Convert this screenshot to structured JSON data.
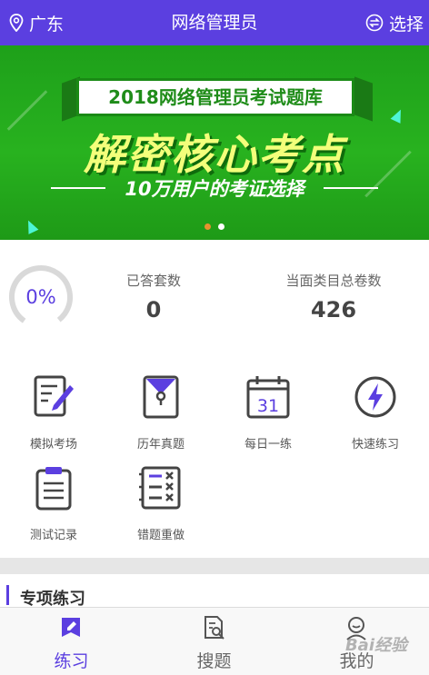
{
  "header": {
    "location": "广东",
    "title": "网络管理员",
    "select_label": "选择"
  },
  "banner": {
    "plate_title": "2018网络管理员考试题库",
    "headline": "解密核心考点",
    "subtitle": "10万用户的考证选择",
    "slide_count": 2,
    "active_slide": 1
  },
  "stats": {
    "progress_percent": "0%",
    "progress_value": 0,
    "answered_label": "已答套数",
    "answered_value": "0",
    "total_label": "当面类目总卷数",
    "total_value": "426"
  },
  "grid": {
    "items": [
      {
        "label": "模拟考场",
        "icon": "pen-paper-icon"
      },
      {
        "label": "历年真题",
        "icon": "envelope-folder-icon"
      },
      {
        "label": "每日一练",
        "icon": "calendar-icon",
        "badge": "31"
      },
      {
        "label": "快速练习",
        "icon": "lightning-icon"
      },
      {
        "label": "测试记录",
        "icon": "clipboard-icon"
      },
      {
        "label": "错题重做",
        "icon": "mistake-list-icon"
      }
    ]
  },
  "section": {
    "title": "专项练习"
  },
  "nav": {
    "items": [
      {
        "label": "练习",
        "icon": "practice-icon",
        "active": true
      },
      {
        "label": "搜题",
        "icon": "search-question-icon",
        "active": false
      },
      {
        "label": "我的",
        "icon": "profile-icon",
        "active": false
      }
    ]
  },
  "watermark": "Bai经验",
  "colors": {
    "primary": "#5b3fe0",
    "banner_green": "#28b21f",
    "headline_yellow": "#f3ff7a",
    "active_dot": "#e8912f"
  }
}
